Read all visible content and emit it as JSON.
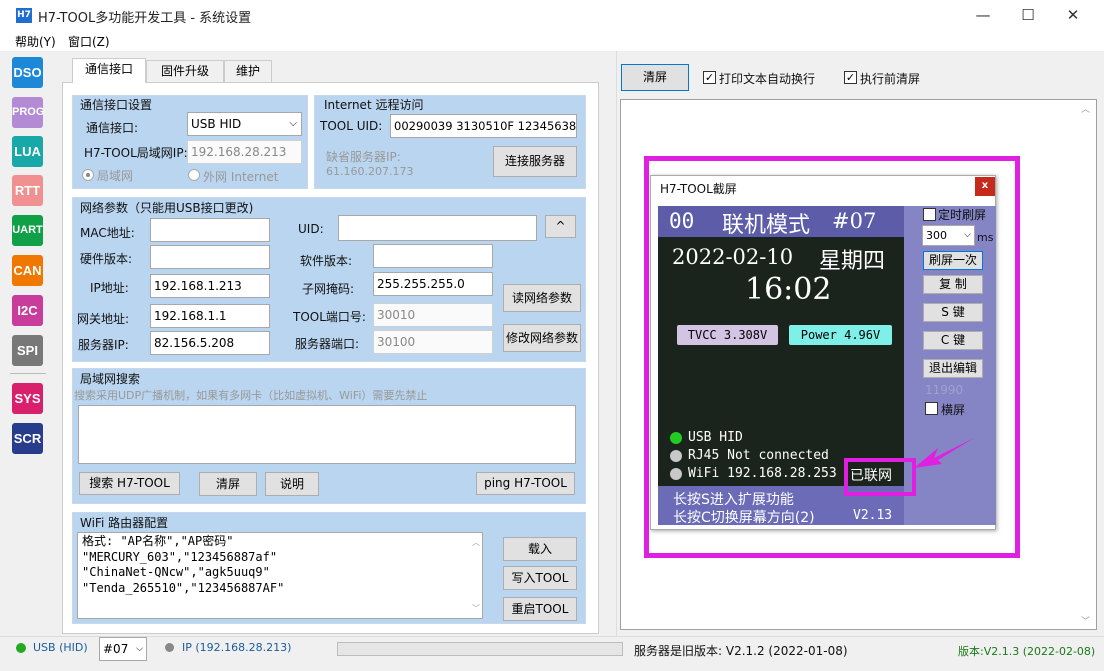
{
  "window": {
    "title": "H7-TOOL多功能开发工具 - 系统设置",
    "app_icon": "H7",
    "min_icon": "—",
    "max_icon": "☐",
    "close_icon": "✕"
  },
  "menu": [
    "帮助(Y)",
    "窗口(Z)"
  ],
  "sidebar": [
    "DSO",
    "PROG",
    "LUA",
    "RTT",
    "UART",
    "CAN",
    "I2C",
    "SPI",
    "SYS",
    "SCR"
  ],
  "sidebar_colors": [
    "#1e88d8",
    "#b38ad4",
    "#18a8a8",
    "#f09090",
    "#10a048",
    "#f07800",
    "#c83c9c",
    "#787878",
    "#d8206c",
    "#283c8c"
  ],
  "tabs": [
    "通信接口",
    "固件升级",
    "维护"
  ],
  "comm": {
    "group_title": "通信接口设置",
    "iface_label": "通信接口:",
    "iface_value": "USB HID",
    "lan_ip_label": "H7-TOOL局域网IP:",
    "lan_ip_value": "192.168.28.213",
    "radio_lan": "局域网",
    "radio_wan": "外网 Internet"
  },
  "remote": {
    "group_title": "Internet 远程访问",
    "uid_label": "TOOL UID:",
    "uid_value": "00290039 3130510F 12345638",
    "default_server_label": "缺省服务器IP:",
    "default_server_ip": "61.160.207.173",
    "connect_button": "连接服务器"
  },
  "net": {
    "group_title": "网络参数（只能用USB接口更改)",
    "mac_label": "MAC地址:",
    "uid_label": "UID:",
    "up_button": "^",
    "hw_label": "硬件版本:",
    "sw_label": "软件版本:",
    "ip_label": "IP地址:",
    "ip_value": "192.168.1.213",
    "mask_label": "子网掩码:",
    "mask_value": "255.255.255.0",
    "gw_label": "网关地址:",
    "gw_value": "192.168.1.1",
    "port_label": "TOOL端口号:",
    "port_value": "30010",
    "server_label": "服务器IP:",
    "server_value": "82.156.5.208",
    "server_port_label": "服务器端口:",
    "server_port_value": "30100",
    "read_button": "读网络参数",
    "modify_button": "修改网络参数"
  },
  "search": {
    "group_title": "局域网搜索",
    "hint": "搜索采用UDP广播机制，如果有多网卡（比如虚拟机、WiFi）需要先禁止",
    "search_button": "搜索 H7-TOOL",
    "clear_button": "清屏",
    "help_button": "说明",
    "ping_button": "ping H7-TOOL"
  },
  "wifi": {
    "group_title": "WiFi 路由器配置",
    "lines": [
      "格式: \"AP名称\",\"AP密码\"",
      "\"MERCURY_603\",\"123456887af\"",
      "\"ChinaNet-QNcw\",\"agk5uuq9\"",
      "\"Tenda_265510\",\"123456887AF\""
    ],
    "load_button": "载入",
    "write_button": "写入TOOL",
    "restart_button": "重启TOOL"
  },
  "right_toolbar": {
    "clear_button": "清屏",
    "wrap_label": "打印文本自动换行",
    "wrap_checked": true,
    "clear_before_label": "执行前清屏",
    "clear_before_checked": true
  },
  "screenshot_popup": {
    "title": "H7-TOOL截屏",
    "close_icon": "x",
    "lcd": {
      "index": "00",
      "mode": "联机模式",
      "number": "#07",
      "date": "2022-02-10",
      "weekday": "星期四",
      "time": "16:02",
      "tvcc": "TVCC 3.308V",
      "power": "Power 4.96V",
      "usb": "USB HID",
      "rj45": "RJ45 Not connected",
      "wifi": "WiFi 192.168.28.253",
      "connected": "已联网",
      "hint1": "长按S进入扩展功能",
      "hint2": "长按C切换屏幕方向(2)",
      "version": "V2.13",
      "usb_color": "#22cc22"
    },
    "timer_refresh_label": "定时刷屏",
    "interval_value": "300",
    "interval_unit": "ms",
    "refresh_once_button": "刷屏一次",
    "copy_button": "复 制",
    "s_key_button": "S 键",
    "c_key_button": "C 键",
    "exit_edit_button": "退出编辑",
    "counter": "11990",
    "landscape_label": "横屏"
  },
  "highlight_color": "#e020e0",
  "statusbar": {
    "usb": "USB (HID)",
    "usb_color": "#22aa22",
    "device_id": "#07",
    "ip": "IP (192.168.28.213)",
    "server_msg": "服务器是旧版本: V2.1.2 (2022-01-08)",
    "version": "版本:V2.1.3 (2022-02-08)",
    "version_color": "#1a7a1a"
  }
}
